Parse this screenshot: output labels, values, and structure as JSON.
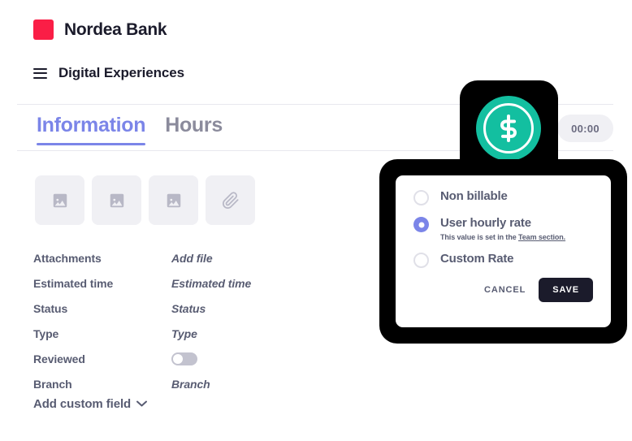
{
  "brand": {
    "name": "Nordea Bank",
    "logo_color": "#fa1e46",
    "logo_icon": "brand-square-icon"
  },
  "project": {
    "menu_icon": "hamburger-menu-icon",
    "name": "Digital Experiences"
  },
  "tabs": [
    {
      "label": "Information",
      "active": true
    },
    {
      "label": "Hours",
      "active": false
    }
  ],
  "accent_color": "#7b85e8",
  "thumbnails": [
    {
      "icon": "image-icon"
    },
    {
      "icon": "image-icon"
    },
    {
      "icon": "image-icon"
    },
    {
      "icon": "paperclip-icon"
    }
  ],
  "fields": [
    {
      "label": "Attachments",
      "value": "Add file",
      "type": "text"
    },
    {
      "label": "Estimated time",
      "value": "Estimated time",
      "type": "text"
    },
    {
      "label": "Status",
      "value": "Status",
      "type": "text"
    },
    {
      "label": "Type",
      "value": "Type",
      "type": "text"
    },
    {
      "label": "Reviewed",
      "value": "",
      "type": "toggle",
      "toggle_on": false
    },
    {
      "label": "Branch",
      "value": "Branch",
      "type": "text"
    }
  ],
  "add_custom_field": {
    "label": "Add custom field",
    "icon": "chevron-down-icon"
  },
  "timer": {
    "value": "00:00",
    "icon": "dollar-coin-icon",
    "coin_color": "#13bfa0"
  },
  "modal": {
    "options": [
      {
        "label": "Non billable",
        "selected": false,
        "help": "",
        "help_link": ""
      },
      {
        "label": "User hourly rate",
        "selected": true,
        "help": "This value is set in the ",
        "help_link": "Team section."
      },
      {
        "label": "Custom Rate",
        "selected": false,
        "help": "",
        "help_link": ""
      }
    ],
    "cancel_label": "CANCEL",
    "save_label": "SAVE"
  }
}
